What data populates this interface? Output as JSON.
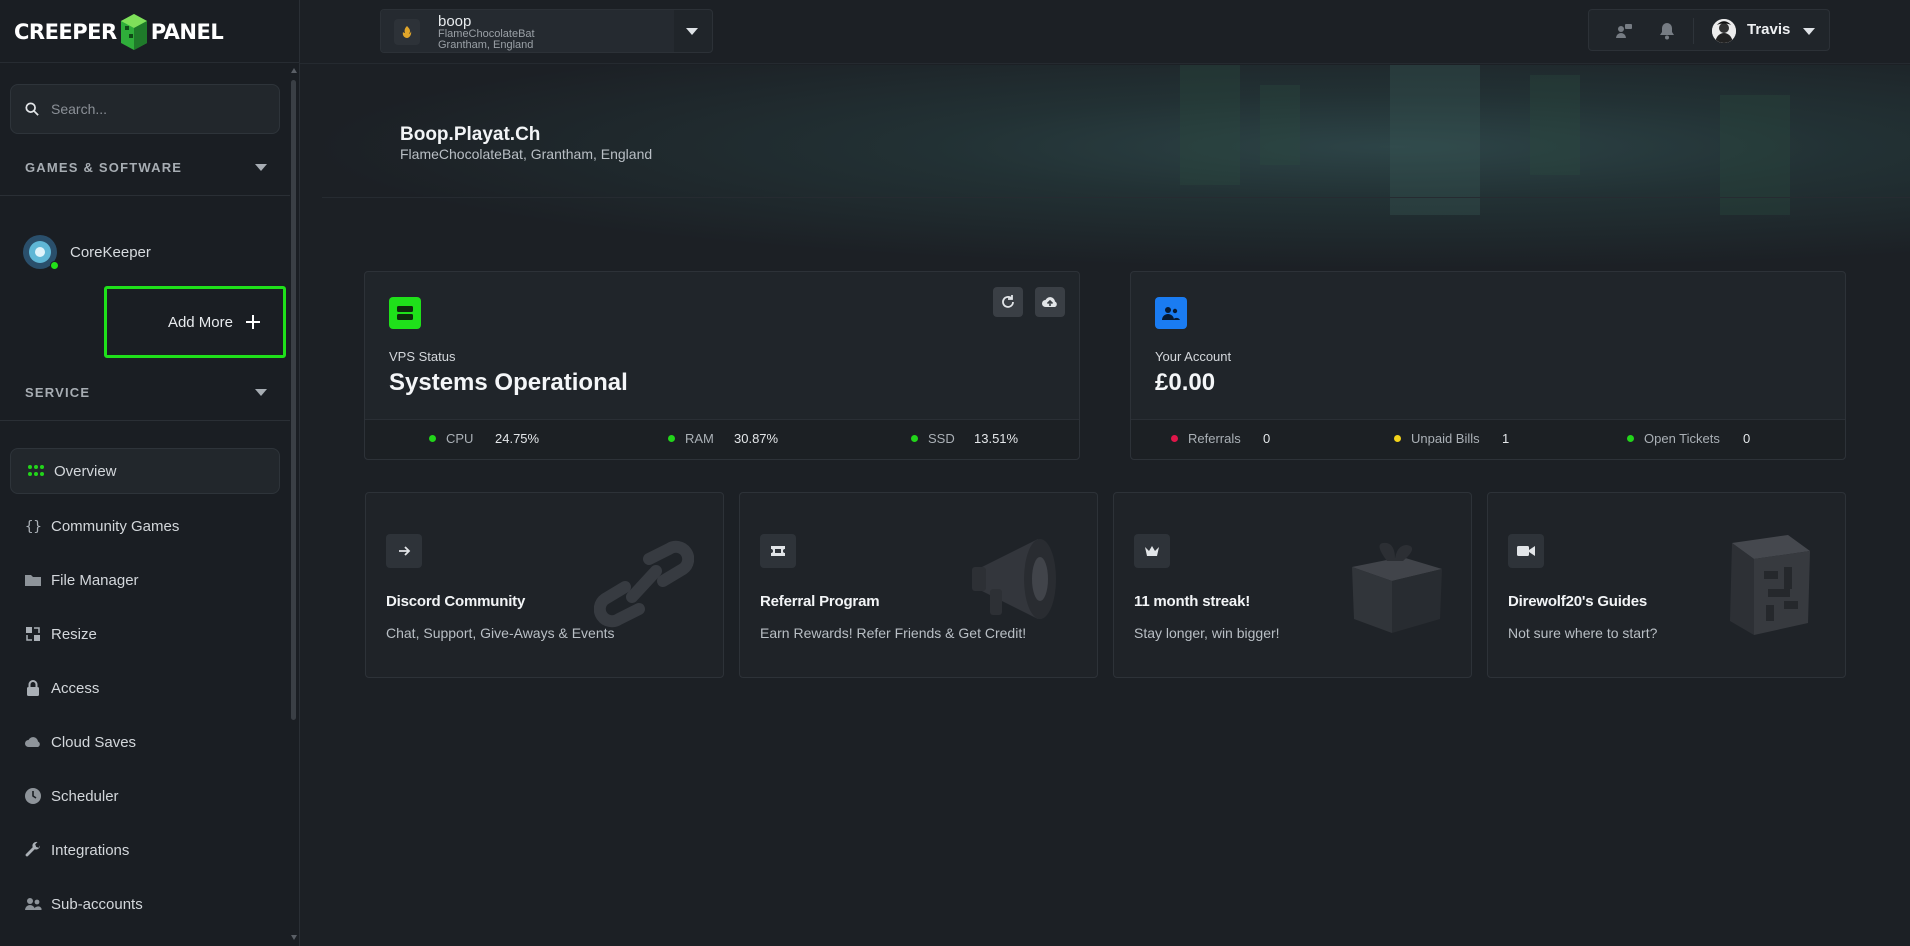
{
  "brand": {
    "logo_left": "CREEPER",
    "logo_right": "PANEL"
  },
  "sidebar": {
    "search_placeholder": "Search...",
    "games_section": "GAMES & SOFTWARE",
    "game": {
      "name": "CoreKeeper",
      "status": "online"
    },
    "add_more": "Add More",
    "service_section": "SERVICE",
    "nav": [
      {
        "label": "Overview",
        "icon": "grid-icon",
        "active": true
      },
      {
        "label": "Community Games",
        "icon": "braces-icon"
      },
      {
        "label": "File Manager",
        "icon": "folder-icon"
      },
      {
        "label": "Resize",
        "icon": "resize-icon"
      },
      {
        "label": "Access",
        "icon": "lock-icon"
      },
      {
        "label": "Cloud Saves",
        "icon": "cloud-icon"
      },
      {
        "label": "Scheduler",
        "icon": "clock-icon"
      },
      {
        "label": "Integrations",
        "icon": "wrench-icon"
      },
      {
        "label": "Sub-accounts",
        "icon": "users-icon"
      }
    ]
  },
  "topbar": {
    "server": {
      "name": "boop",
      "line1": "FlameChocolateBat",
      "line2": "Grantham, England"
    },
    "user": {
      "name": "Travis"
    }
  },
  "hero": {
    "title": "Boop.Playat.Ch",
    "subtitle": "FlameChocolateBat, Grantham, England"
  },
  "vps": {
    "label": "VPS Status",
    "value": "Systems Operational",
    "metrics": [
      {
        "key": "CPU",
        "value": "24.75%",
        "color": "#22d51a"
      },
      {
        "key": "RAM",
        "value": "30.87%",
        "color": "#22d51a"
      },
      {
        "key": "SSD",
        "value": "13.51%",
        "color": "#22d51a"
      }
    ]
  },
  "account": {
    "label": "Your Account",
    "value": "£0.00",
    "metrics": [
      {
        "key": "Referrals",
        "value": "0",
        "color": "#e0164a"
      },
      {
        "key": "Unpaid Bills",
        "value": "1",
        "color": "#f2d21a"
      },
      {
        "key": "Open Tickets",
        "value": "0",
        "color": "#22d51a"
      }
    ]
  },
  "promos": [
    {
      "title": "Discord Community",
      "subtitle": "Chat, Support, Give-Aways & Events",
      "icon": "arrow-right-icon"
    },
    {
      "title": "Referral Program",
      "subtitle": "Earn Rewards! Refer Friends & Get Credit!",
      "icon": "ticket-icon"
    },
    {
      "title": "11 month streak!",
      "subtitle": "Stay longer, win bigger!",
      "icon": "crown-icon"
    },
    {
      "title": "Direwolf20's Guides",
      "subtitle": "Not sure where to start?",
      "icon": "video-icon"
    }
  ],
  "colors": {
    "accent_green": "#1fe01a",
    "accent_blue": "#1a7cf2",
    "background": "#1c2025"
  }
}
